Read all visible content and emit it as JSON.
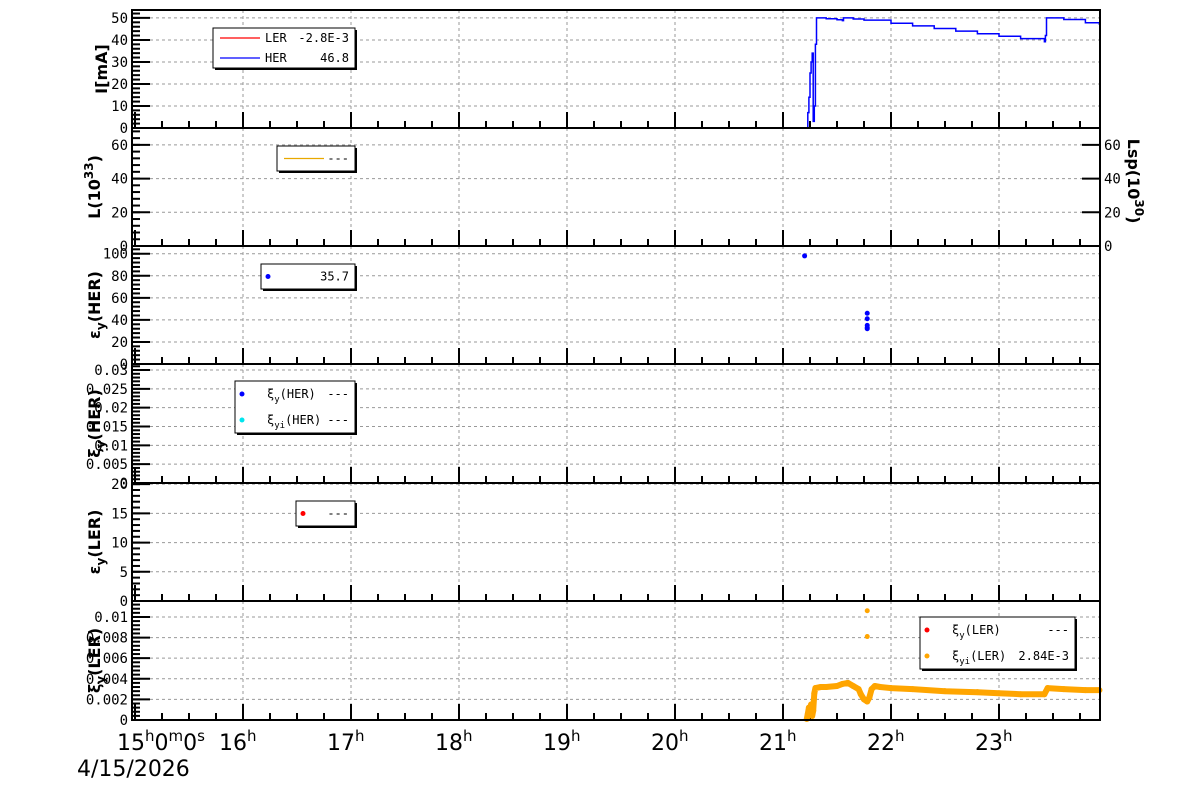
{
  "chart_data": {
    "type": "line",
    "x_unit": "hour of day",
    "xlim": [
      15.0,
      23.93
    ],
    "x_ticks": [
      {
        "value": 15,
        "label": "15",
        "sup": "h",
        "extra": "0m0s"
      },
      {
        "value": 16,
        "label": "16",
        "sup": "h"
      },
      {
        "value": 17,
        "label": "17",
        "sup": "h"
      },
      {
        "value": 18,
        "label": "18",
        "sup": "h"
      },
      {
        "value": 19,
        "label": "19",
        "sup": "h"
      },
      {
        "value": 20,
        "label": "20",
        "sup": "h"
      },
      {
        "value": 21,
        "label": "21",
        "sup": "h"
      },
      {
        "value": 22,
        "label": "22",
        "sup": "h"
      },
      {
        "value": 23,
        "label": "23",
        "sup": "h"
      }
    ],
    "date_label": "4/15/2026",
    "grid": true,
    "panels": [
      {
        "id": "current",
        "ylabel": {
          "main": "I[mA]",
          "sub": "",
          "rest": "",
          "sup": ""
        },
        "ylim": [
          0,
          53.6
        ],
        "yticks": [
          0,
          10,
          20,
          30,
          40,
          50
        ],
        "ytick_labels": [
          "0",
          "10",
          "20",
          "30",
          "40",
          "50"
        ],
        "series": [
          {
            "name": "LER",
            "value": "-2.8E-3",
            "color": "#ff0000",
            "style": "step",
            "x": [
              15.0,
              21.22,
              23.93
            ],
            "y": [
              0,
              0,
              0
            ]
          },
          {
            "name": "HER",
            "value": "46.8",
            "color": "#0000ff",
            "style": "step",
            "x": [
              15.0,
              21.22,
              21.23,
              21.24,
              21.25,
              21.26,
              21.27,
              21.28,
              21.29,
              21.3,
              21.31,
              21.4,
              21.5,
              21.55,
              21.56,
              21.65,
              21.75,
              22.0,
              22.2,
              22.4,
              22.6,
              22.8,
              23.0,
              23.2,
              23.42,
              23.43,
              23.44,
              23.6,
              23.8,
              23.93
            ],
            "y": [
              0,
              0,
              7,
              14,
              25,
              30,
              34,
              3,
              10,
              38,
              50,
              49.6,
              49.2,
              48.8,
              50,
              49.5,
              49.0,
              47.6,
              46.4,
              45.2,
              44.0,
              42.8,
              41.7,
              40.6,
              39.2,
              42,
              50,
              49.3,
              47.8,
              46.8
            ]
          }
        ],
        "legend": {
          "position": "top-left",
          "entries": [
            {
              "label": "LER",
              "value": "-2.8E-3"
            },
            {
              "label": "HER",
              "value": "46.8"
            }
          ]
        }
      },
      {
        "id": "luminosity",
        "ylabel": {
          "main": "L(10",
          "sup": "33",
          "rest": ")",
          "sub": ""
        },
        "right_ylabel": {
          "main": "Lsp(10",
          "sup": "30",
          "rest": ")"
        },
        "ylim": [
          0,
          70
        ],
        "yticks": [
          0,
          20,
          40,
          60
        ],
        "ytick_labels": [
          "0",
          "20",
          "40",
          "60"
        ],
        "right_ytick_labels": [
          "0",
          "20",
          "40",
          "60"
        ],
        "series": [
          {
            "name": "L",
            "value": "---",
            "color": "#e8a800",
            "style": "line",
            "x": [],
            "y": []
          }
        ],
        "legend": {
          "position": "top-left",
          "entries": [
            {
              "label": "",
              "value": "---"
            }
          ]
        }
      },
      {
        "id": "emittance-her",
        "ylabel": {
          "main": "ε",
          "sub": "y",
          "rest": "(HER)",
          "sup": ""
        },
        "ylim": [
          0,
          107
        ],
        "yticks": [
          0,
          20,
          40,
          60,
          80,
          100
        ],
        "ytick_labels": [
          "0",
          "20",
          "40",
          "60",
          "80",
          "100"
        ],
        "series": [
          {
            "name": "eps_y HER",
            "value": "35.7",
            "color": "#0000ff",
            "style": "points",
            "x": [
              21.2,
              21.78,
              21.78,
              21.78,
              21.78,
              21.78
            ],
            "y": [
              98,
              46,
              41,
              35,
              33,
              32
            ]
          }
        ],
        "legend": {
          "position": "top-left",
          "entries": [
            {
              "label": "",
              "value": "35.7"
            }
          ]
        }
      },
      {
        "id": "beambeam-her",
        "ylabel": {
          "main": "ξ",
          "sub": "y",
          "rest": "(HER)",
          "sup": ""
        },
        "ylim": [
          0,
          0.0316
        ],
        "yticks": [
          0,
          0.005,
          0.01,
          0.015,
          0.02,
          0.025,
          0.03
        ],
        "ytick_labels": [
          "0",
          "0.005",
          "0.01",
          "0.015",
          "0.02",
          "0.025",
          "0.03"
        ],
        "series": [
          {
            "name": "xi_y HER",
            "value": "---",
            "color": "#0000ff",
            "style": "points",
            "x": [],
            "y": []
          },
          {
            "name": "xi_yi HER",
            "value": "---",
            "color": "#00e5ee",
            "style": "points",
            "x": [],
            "y": []
          }
        ],
        "legend": {
          "position": "top-left",
          "entries": [
            {
              "label": "ξ",
              "sub": "y",
              "rest": "(HER)",
              "value": "---"
            },
            {
              "label": "ξ",
              "sub": "yi",
              "rest": "(HER)",
              "value": "---"
            }
          ]
        }
      },
      {
        "id": "emittance-ler",
        "ylabel": {
          "main": "ε",
          "sub": "y",
          "rest": "(LER)",
          "sup": ""
        },
        "ylim": [
          0,
          20.2
        ],
        "yticks": [
          0,
          5,
          10,
          15,
          20
        ],
        "ytick_labels": [
          "0",
          "5",
          "10",
          "15",
          "20"
        ],
        "series": [
          {
            "name": "eps_y LER",
            "value": "---",
            "color": "#ff0000",
            "style": "points",
            "x": [],
            "y": []
          }
        ],
        "legend": {
          "position": "top-left",
          "entries": [
            {
              "label": "",
              "value": "---"
            }
          ]
        }
      },
      {
        "id": "beambeam-ler",
        "ylabel": {
          "main": "ξ",
          "sub": "y",
          "rest": "(LER)",
          "sup": ""
        },
        "ylim": [
          0,
          0.01155
        ],
        "yticks": [
          0,
          0.002,
          0.004,
          0.006,
          0.008,
          0.01
        ],
        "ytick_labels": [
          "0",
          "0.002",
          "0.004",
          "0.006",
          "0.008",
          "0.01"
        ],
        "series": [
          {
            "name": "xi_y LER",
            "value": "---",
            "color": "#ff0000",
            "style": "points",
            "x": [],
            "y": []
          },
          {
            "name": "xi_yi LER",
            "value": "2.84E-3",
            "color": "#ffa500",
            "style": "band",
            "x": [
              21.22,
              21.23,
              21.24,
              21.25,
              21.26,
              21.27,
              21.28,
              21.29,
              21.3,
              21.35,
              21.4,
              21.5,
              21.55,
              21.6,
              21.65,
              21.7,
              21.72,
              21.75,
              21.78,
              21.8,
              21.82,
              21.85,
              21.9,
              22.0,
              22.2,
              22.5,
              22.8,
              23.0,
              23.2,
              23.42,
              23.45,
              23.6,
              23.8,
              23.93
            ],
            "y": [
              0.0001,
              0.0006,
              0.0012,
              0.0008,
              0.0015,
              0.0004,
              0.0009,
              0.0026,
              0.0031,
              0.0032,
              0.0032,
              0.0033,
              0.0035,
              0.0036,
              0.0033,
              0.003,
              0.0025,
              0.002,
              0.0018,
              0.0022,
              0.003,
              0.0033,
              0.0032,
              0.0031,
              0.003,
              0.0028,
              0.0027,
              0.0026,
              0.0025,
              0.0025,
              0.0031,
              0.003,
              0.0029,
              0.0029
            ]
          },
          {
            "name": "xi_yi LER outliers",
            "color": "#ffa500",
            "style": "points",
            "x": [
              21.78,
              21.78
            ],
            "y": [
              0.0106,
              0.0081
            ]
          }
        ],
        "legend": {
          "position": "top-right",
          "entries": [
            {
              "label": "ξ",
              "sub": "y",
              "rest": "(LER)",
              "value": "---"
            },
            {
              "label": "ξ",
              "sub": "yi",
              "rest": "(LER)",
              "value": "2.84E-3"
            }
          ]
        }
      }
    ]
  }
}
